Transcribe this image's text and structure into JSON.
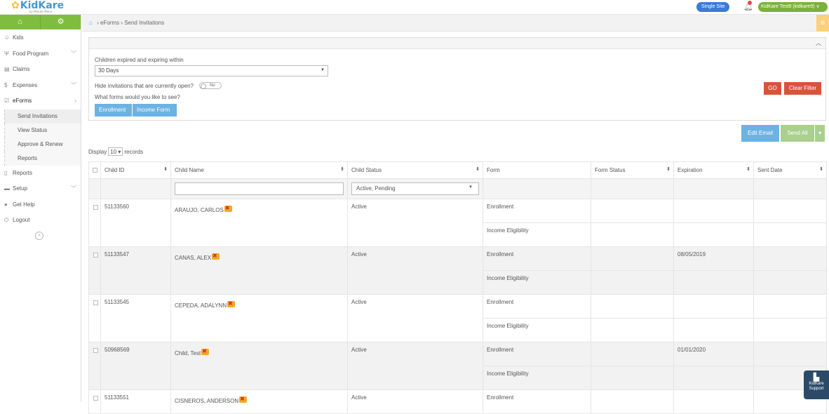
{
  "topbar": {
    "logo": "KidKare",
    "logo_sub": "by Minute Menu",
    "site_btn": "Single Site",
    "user": "KidKare Test9 (kidkare9) ∨"
  },
  "sidebar": {
    "items": [
      {
        "label": "Kids"
      },
      {
        "label": "Food Program"
      },
      {
        "label": "Claims"
      },
      {
        "label": "Expenses"
      },
      {
        "label": "eForms"
      }
    ],
    "sub": [
      "Send Invitations",
      "View Status",
      "Approve & Renew",
      "Reports"
    ],
    "items2": [
      {
        "label": "Reports"
      },
      {
        "label": "Setup"
      },
      {
        "label": "Get Help"
      },
      {
        "label": "Logout"
      }
    ]
  },
  "breadcrumb": {
    "parent": "eForms",
    "current": "Send Invitations"
  },
  "filter": {
    "expiring_label": "Children expired and expiring within",
    "expiring_value": "30 Days",
    "hide_label": "Hide invitations that are currently open?",
    "toggle": "No",
    "forms_label": "What forms would you like to see?",
    "form_buttons": [
      "Enrollment",
      "Income Form"
    ],
    "go": "GO",
    "clear": "Clear Filter"
  },
  "actions": {
    "edit_email": "Edit Email",
    "send_all": "Send All"
  },
  "display": {
    "pre": "Display",
    "value": "10",
    "post": "records"
  },
  "table": {
    "headers": [
      "Child ID",
      "Child Name",
      "Child Status",
      "Form",
      "Form Status",
      "Expiration",
      "Sent Date"
    ],
    "status_filter": "Active, Pending",
    "rows": [
      {
        "id": "51133560",
        "name": "ARAUJO, CARLOS",
        "status": "Active",
        "forms": [
          {
            "form": "Enrollment",
            "exp": ""
          },
          {
            "form": "Income Eligibility",
            "exp": ""
          }
        ]
      },
      {
        "id": "51133547",
        "name": "CANAS, ALEX",
        "status": "Active",
        "forms": [
          {
            "form": "Enrollment",
            "exp": "08/05/2019"
          },
          {
            "form": "Income Eligibility",
            "exp": ""
          }
        ]
      },
      {
        "id": "51133545",
        "name": "CEPEDA, ADALYNN",
        "status": "Active",
        "forms": [
          {
            "form": "Enrollment",
            "exp": ""
          },
          {
            "form": "Income Eligibility",
            "exp": ""
          }
        ]
      },
      {
        "id": "50968569",
        "name": "Child, Test",
        "status": "Active",
        "forms": [
          {
            "form": "Enrollment",
            "exp": "01/01/2020"
          },
          {
            "form": "Income Eligibility",
            "exp": ""
          }
        ]
      },
      {
        "id": "51133551",
        "name": "CISNEROS, ANDERSON",
        "status": "Active",
        "forms": [
          {
            "form": "Enrollment",
            "exp": ""
          }
        ]
      }
    ]
  },
  "support": {
    "line1": "KidKare",
    "line2": "Support"
  }
}
